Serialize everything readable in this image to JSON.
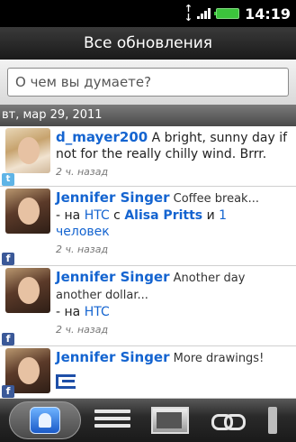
{
  "status_bar": {
    "time": "14:19",
    "icons": [
      "data-transfer-icon",
      "signal-strength-icon",
      "battery-icon"
    ],
    "battery_color": "#3cc43c"
  },
  "header": {
    "title": "Все обновления"
  },
  "search": {
    "placeholder": "О чем вы думаете?"
  },
  "feed": {
    "date_label": "вт, мар 29, 2011",
    "items": [
      {
        "network": "twitter",
        "author": "d_mayer200",
        "text": " A bright, sunny day if not for the really chilly wind. Brrr.",
        "time": "2 ч. назад"
      },
      {
        "network": "facebook",
        "author": "Jennifer Singer",
        "text": " Coffee break...",
        "prefix": "- на ",
        "place": "HTC",
        "with": " с ",
        "person": "Alisa Pritts",
        "and": " и ",
        "count": "1",
        "count_suffix": "человек",
        "time": "2 ч. назад"
      },
      {
        "network": "facebook",
        "author": "Jennifer Singer",
        "text": " Another day another dollar...",
        "prefix": "- на ",
        "place": "HTC",
        "time": "2 ч. назад"
      },
      {
        "network": "facebook",
        "author": "Jennifer Singer",
        "text": " More drawings!"
      }
    ]
  },
  "tabs": [
    {
      "icon": "all-updates-icon",
      "active": true
    },
    {
      "icon": "comments-icon"
    },
    {
      "icon": "photos-icon"
    },
    {
      "icon": "links-icon"
    },
    {
      "icon": "more-icon"
    }
  ]
}
